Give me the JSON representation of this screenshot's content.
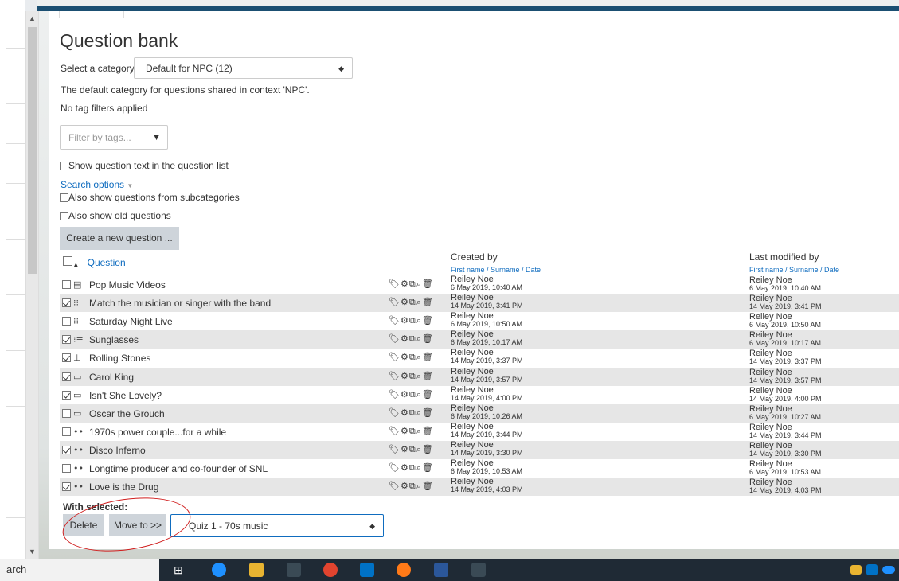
{
  "page": {
    "title": "Question bank",
    "category_label": "Select a category:",
    "category_value": "Default for NPC (12)",
    "category_description": "The default category for questions shared in context 'NPC'.",
    "tag_filter_status": "No tag filters applied",
    "tag_filter_placeholder": "Filter by tags...",
    "show_text_label": "Show question text in the question list",
    "search_options": "Search options",
    "subcat_label": "Also show questions from subcategories",
    "old_label": "Also show old questions",
    "create_button": "Create a new question ..."
  },
  "table": {
    "header_question": "Question",
    "header_created": "Created by",
    "header_modified": "Last modified by",
    "header_sub": "First name / Surname / Date",
    "rows": [
      {
        "checked": false,
        "type_glyph": "▤",
        "name": "Pop Music Videos",
        "created_by": "Reiley Noe",
        "created_date": "6 May 2019, 10:40 AM",
        "modified_by": "Reiley Noe",
        "modified_date": "6 May 2019, 10:40 AM"
      },
      {
        "checked": true,
        "type_glyph": "⁝⁝",
        "name": "Match the musician or singer with the band",
        "created_by": "Reiley Noe",
        "created_date": "14 May 2019, 3:41 PM",
        "modified_by": "Reiley Noe",
        "modified_date": "14 May 2019, 3:41 PM"
      },
      {
        "checked": false,
        "type_glyph": "⁝⁝",
        "name": "Saturday Night Live",
        "created_by": "Reiley Noe",
        "created_date": "6 May 2019, 10:50 AM",
        "modified_by": "Reiley Noe",
        "modified_date": "6 May 2019, 10:50 AM"
      },
      {
        "checked": true,
        "type_glyph": "⁝≡",
        "name": "Sunglasses",
        "created_by": "Reiley Noe",
        "created_date": "6 May 2019, 10:17 AM",
        "modified_by": "Reiley Noe",
        "modified_date": "6 May 2019, 10:17 AM"
      },
      {
        "checked": true,
        "type_glyph": "⊥",
        "name": "Rolling Stones",
        "created_by": "Reiley Noe",
        "created_date": "14 May 2019, 3:37 PM",
        "modified_by": "Reiley Noe",
        "modified_date": "14 May 2019, 3:37 PM"
      },
      {
        "checked": true,
        "type_glyph": "▭",
        "name": "Carol King",
        "created_by": "Reiley Noe",
        "created_date": "14 May 2019, 3:57 PM",
        "modified_by": "Reiley Noe",
        "modified_date": "14 May 2019, 3:57 PM"
      },
      {
        "checked": true,
        "type_glyph": "▭",
        "name": "Isn't She Lovely?",
        "created_by": "Reiley Noe",
        "created_date": "14 May 2019, 4:00 PM",
        "modified_by": "Reiley Noe",
        "modified_date": "14 May 2019, 4:00 PM"
      },
      {
        "checked": false,
        "type_glyph": "▭",
        "name": "Oscar the Grouch",
        "created_by": "Reiley Noe",
        "created_date": "6 May 2019, 10:26 AM",
        "modified_by": "Reiley Noe",
        "modified_date": "6 May 2019, 10:27 AM"
      },
      {
        "checked": false,
        "type_glyph": "••",
        "name": "1970s power couple...for a while",
        "created_by": "Reiley Noe",
        "created_date": "14 May 2019, 3:44 PM",
        "modified_by": "Reiley Noe",
        "modified_date": "14 May 2019, 3:44 PM"
      },
      {
        "checked": true,
        "type_glyph": "••",
        "name": "Disco Inferno",
        "created_by": "Reiley Noe",
        "created_date": "14 May 2019, 3:30 PM",
        "modified_by": "Reiley Noe",
        "modified_date": "14 May 2019, 3:30 PM"
      },
      {
        "checked": false,
        "type_glyph": "••",
        "name": "Longtime producer and co-founder of SNL",
        "created_by": "Reiley Noe",
        "created_date": "6 May 2019, 10:53 AM",
        "modified_by": "Reiley Noe",
        "modified_date": "6 May 2019, 10:53 AM"
      },
      {
        "checked": true,
        "type_glyph": "••",
        "name": "Love is the Drug",
        "created_by": "Reiley Noe",
        "created_date": "14 May 2019, 4:03 PM",
        "modified_by": "Reiley Noe",
        "modified_date": "14 May 2019, 4:03 PM"
      }
    ]
  },
  "bulk": {
    "with_selected": "With selected:",
    "delete_button": "Delete",
    "move_button": "Move to >>",
    "move_target": "Quiz 1 - 70s music"
  },
  "taskbar": {
    "search_text": "arch"
  },
  "colors": {
    "link": "#0f6cbf",
    "row_alt": "#e6e6e6",
    "annotation_red": "#d01e1e"
  }
}
